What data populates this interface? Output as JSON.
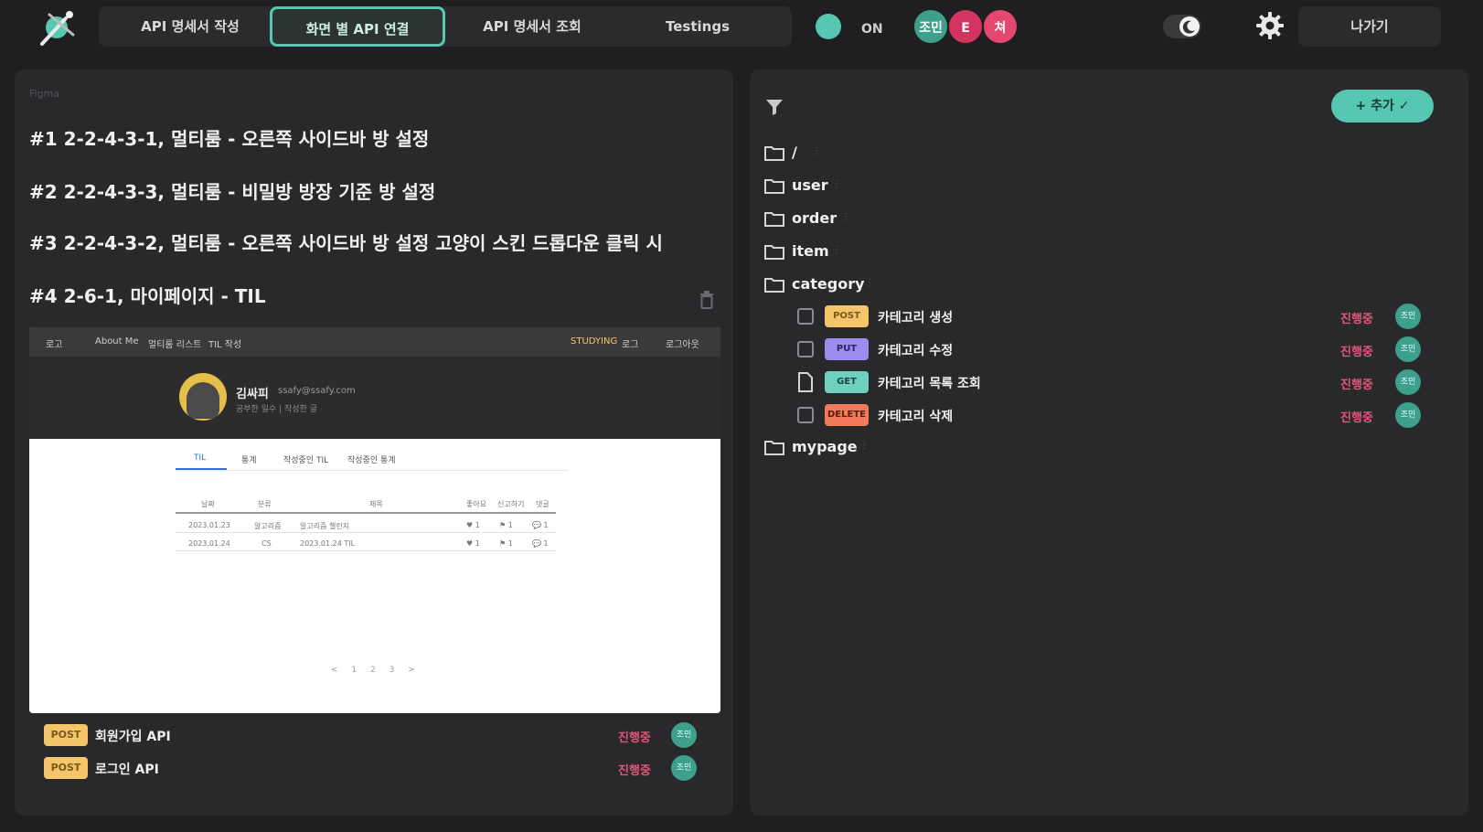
{
  "colors": {
    "accent": "#56c7b1",
    "background": "#1f1f21",
    "panel": "#29292c",
    "in_progress": "#e0557a",
    "post": "#f4c56b",
    "put": "#9c8cf0",
    "get": "#6fd0c0",
    "delete": "#f07a5a"
  },
  "topbar": {
    "logo_icon": "satellite-logo-icon",
    "tabs": [
      {
        "label": "API 명세서 작성"
      },
      {
        "label": "화면 별 API 연결"
      },
      {
        "label": "API 명세서 조회"
      },
      {
        "label": "Testings"
      }
    ],
    "status_text": "ON",
    "avatars": [
      {
        "label": "조민",
        "color": "#3e9f8a"
      },
      {
        "label": "E",
        "color": "#d2335f"
      },
      {
        "label": "쳐",
        "color": "#e5476e"
      }
    ],
    "toggle_icon": "moon-icon",
    "gear_icon": "gear-icon",
    "exit_label": "나가기"
  },
  "left": {
    "figma_label": "Figma",
    "comments": [
      "#1 2-2-4-3-1, 멀티룸 - 오른쪽 사이드바 방 설정",
      "#2 2-2-4-3-3, 멀티룸 - 비밀방 방장 기준 방 설정",
      "#3 2-2-4-3-2, 멀티룸 - 오른쪽 사이드바 방 설정 고양이 스킨 드롭다운 클릭 시",
      "#4 2-6-1, 마이페이지 - TIL"
    ],
    "preview": {
      "nav_items": [
        "로고",
        "About Me",
        "멀티룸 리스트",
        "TIL 작성"
      ],
      "nav_right": [
        "STUDYING",
        "로그",
        "로그아웃"
      ],
      "name": "김싸피",
      "email": "ssafy@ssafy.com",
      "sub": "공부한 일수 | 작성한 글",
      "tabs": [
        "TIL",
        "통계",
        "작성중인 TIL",
        "작성중인 통계"
      ],
      "table_headers": [
        "날짜",
        "분류",
        "제목",
        "좋아요",
        "신고하기",
        "댓글"
      ],
      "rows": [
        [
          "2023.01.23",
          "알고리즘",
          "알고리즘 챌린지",
          "♥ 1",
          "⚑ 1",
          "💬 1"
        ],
        [
          "2023.01.24",
          "CS",
          "2023.01.24 TIL",
          "♥ 1",
          "⚑ 1",
          "💬 1"
        ]
      ],
      "pages": "< 1 2 3 >"
    },
    "apis": [
      {
        "method": "POST",
        "name": "회원가입 API",
        "state": "진행중",
        "owner": "조민"
      },
      {
        "method": "POST",
        "name": "로그인 API",
        "state": "진행중",
        "owner": "조민"
      }
    ]
  },
  "right": {
    "add_label": "+ 추가  ✓",
    "folders": [
      {
        "name": "/"
      },
      {
        "name": "user"
      },
      {
        "name": "order"
      },
      {
        "name": "item"
      },
      {
        "name": "category"
      }
    ],
    "category_apis": [
      {
        "method": "POST",
        "name": "카테고리 생성",
        "state": "진행중",
        "owner": "조민"
      },
      {
        "method": "PUT",
        "name": "카테고리 수정",
        "state": "진행중",
        "owner": "조민"
      },
      {
        "method": "GET",
        "name": "카테고리 목록 조회",
        "state": "진행중",
        "owner": "조민"
      },
      {
        "method": "DELETE",
        "name": "카테고리 삭제",
        "state": "진행중",
        "owner": "조민"
      }
    ],
    "last_folder": {
      "name": "mypage"
    }
  }
}
